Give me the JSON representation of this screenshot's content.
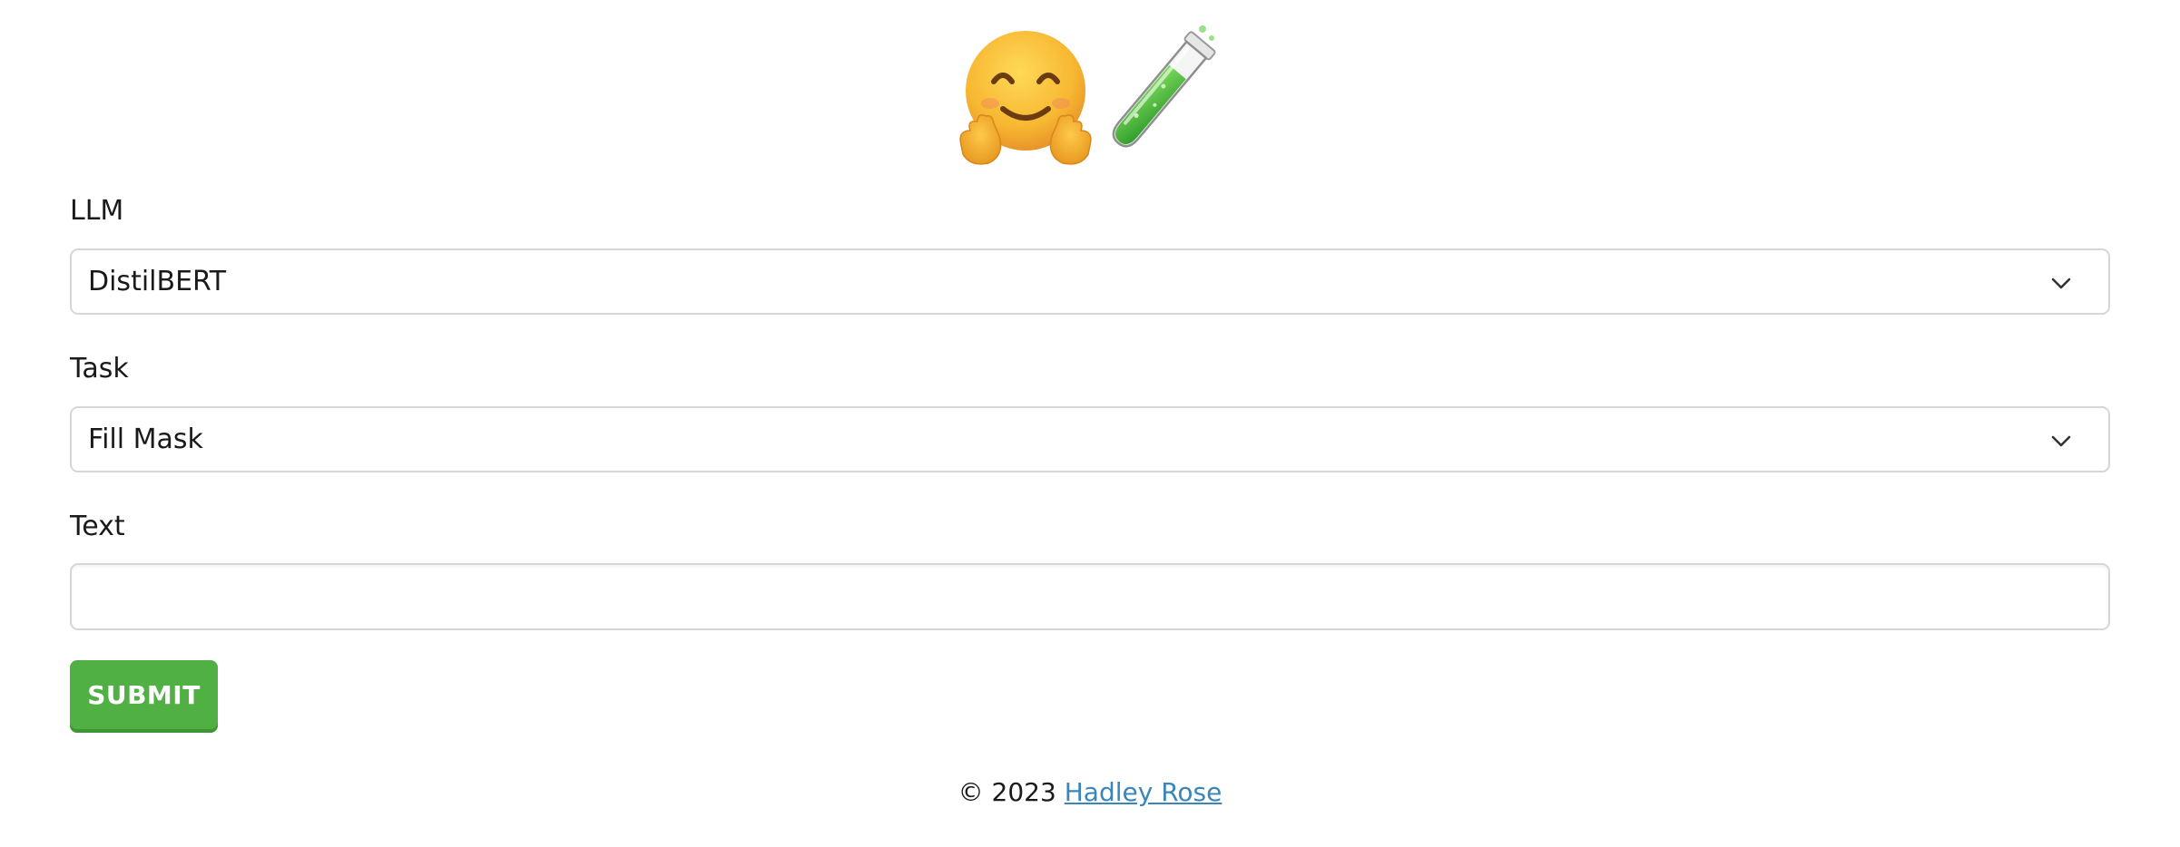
{
  "form": {
    "llm": {
      "label": "LLM",
      "selected": "DistilBERT"
    },
    "task": {
      "label": "Task",
      "selected": "Fill Mask"
    },
    "text": {
      "label": "Text",
      "value": "",
      "placeholder": ""
    },
    "submit_label": "SUBMIT"
  },
  "footer": {
    "copyright": "© 2023",
    "author_link": "Hadley Rose"
  },
  "icons": {
    "logo_left": "hugging-face-icon",
    "logo_right": "test-tube-icon",
    "dropdown": "chevron-down-icon"
  },
  "colors": {
    "submit_button": "#51b043",
    "link": "#3a86b8",
    "border": "#d6d6d6"
  }
}
